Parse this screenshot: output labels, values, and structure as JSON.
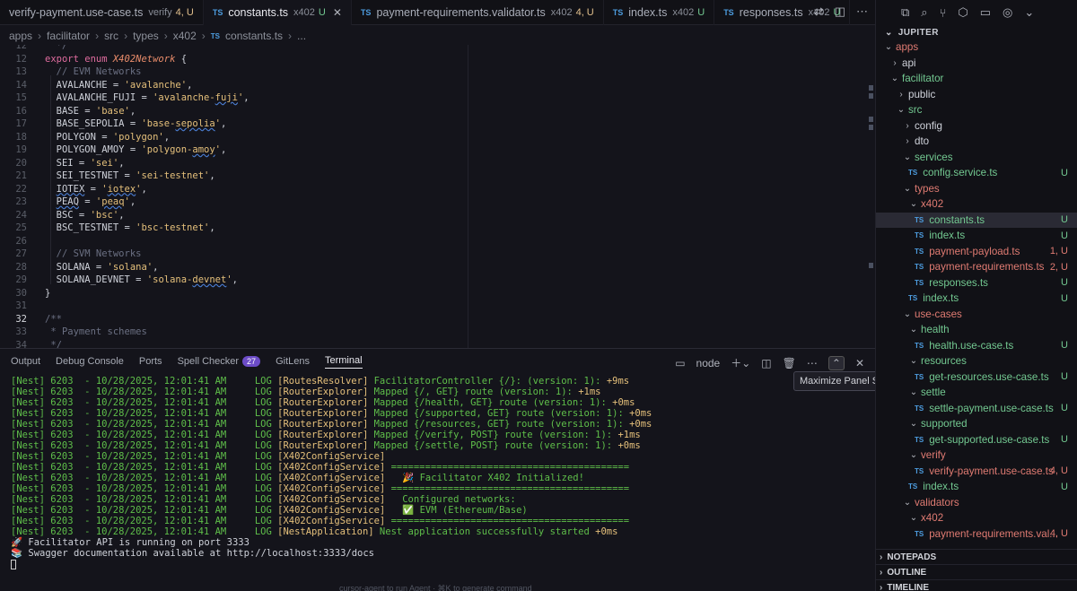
{
  "tabs": [
    {
      "label": "verify-payment.use-case.ts",
      "hint": "verify",
      "status": "4, U",
      "status_color": "#e2c08d",
      "icon": ""
    },
    {
      "label": "constants.ts",
      "hint": "x402",
      "status": "U",
      "status_color": "#73c991",
      "icon": "TS",
      "close": "✕"
    },
    {
      "label": "payment-requirements.validator.ts",
      "hint": "x402",
      "status": "4, U",
      "status_color": "#e2c08d",
      "icon": "TS"
    },
    {
      "label": "index.ts",
      "hint": "x402",
      "status": "U",
      "status_color": "#73c991",
      "icon": "TS"
    },
    {
      "label": "responses.ts",
      "hint": "x402",
      "status": "U",
      "status_color": "#73c991",
      "icon": "TS"
    }
  ],
  "breadcrumb": [
    "apps",
    "facilitator",
    "src",
    "types",
    "x402",
    "constants.ts",
    "..."
  ],
  "breadcrumb_icon": "TS",
  "code_lines": [
    {
      "n": "12",
      "parts": [
        {
          "t": "  */",
          "c": "cm"
        }
      ]
    },
    {
      "n": "12",
      "parts": [
        {
          "t": "export enum ",
          "c": "kw"
        },
        {
          "t": "X402Network",
          "c": "ty"
        },
        {
          "t": " {",
          "c": ""
        }
      ]
    },
    {
      "n": "13",
      "parts": [
        {
          "t": "  // EVM Networks",
          "c": "cm"
        }
      ]
    },
    {
      "n": "14",
      "parts": [
        {
          "t": "  AVALANCHE = ",
          "c": ""
        },
        {
          "t": "'avalanche'",
          "c": "str"
        },
        {
          "t": ",",
          "c": ""
        }
      ]
    },
    {
      "n": "15",
      "parts": [
        {
          "t": "  AVALANCHE_FUJI = ",
          "c": ""
        },
        {
          "t": "'avalanche-",
          "c": "str"
        },
        {
          "t": "fuji",
          "c": "str sq"
        },
        {
          "t": "'",
          "c": "str"
        },
        {
          "t": ",",
          "c": ""
        }
      ]
    },
    {
      "n": "16",
      "parts": [
        {
          "t": "  BASE = ",
          "c": ""
        },
        {
          "t": "'base'",
          "c": "str"
        },
        {
          "t": ",",
          "c": ""
        }
      ]
    },
    {
      "n": "17",
      "parts": [
        {
          "t": "  BASE_SEPOLIA = ",
          "c": ""
        },
        {
          "t": "'base-",
          "c": "str"
        },
        {
          "t": "sepolia",
          "c": "str sq"
        },
        {
          "t": "'",
          "c": "str"
        },
        {
          "t": ",",
          "c": ""
        }
      ]
    },
    {
      "n": "18",
      "parts": [
        {
          "t": "  POLYGON = ",
          "c": ""
        },
        {
          "t": "'polygon'",
          "c": "str"
        },
        {
          "t": ",",
          "c": ""
        }
      ]
    },
    {
      "n": "19",
      "parts": [
        {
          "t": "  POLYGON_AMOY = ",
          "c": ""
        },
        {
          "t": "'polygon-",
          "c": "str"
        },
        {
          "t": "amoy",
          "c": "str sq"
        },
        {
          "t": "'",
          "c": "str"
        },
        {
          "t": ",",
          "c": ""
        }
      ]
    },
    {
      "n": "20",
      "parts": [
        {
          "t": "  SEI = ",
          "c": ""
        },
        {
          "t": "'sei'",
          "c": "str"
        },
        {
          "t": ",",
          "c": ""
        }
      ]
    },
    {
      "n": "21",
      "parts": [
        {
          "t": "  SEI_TESTNET = ",
          "c": ""
        },
        {
          "t": "'sei-testnet'",
          "c": "str"
        },
        {
          "t": ",",
          "c": ""
        }
      ]
    },
    {
      "n": "22",
      "parts": [
        {
          "t": "  ",
          "c": ""
        },
        {
          "t": "IOTEX",
          "c": "sq"
        },
        {
          "t": " = ",
          "c": ""
        },
        {
          "t": "'",
          "c": "str"
        },
        {
          "t": "iotex",
          "c": "str sq"
        },
        {
          "t": "'",
          "c": "str"
        },
        {
          "t": ",",
          "c": ""
        }
      ]
    },
    {
      "n": "23",
      "parts": [
        {
          "t": "  ",
          "c": ""
        },
        {
          "t": "PEAQ",
          "c": "sq"
        },
        {
          "t": " = ",
          "c": ""
        },
        {
          "t": "'",
          "c": "str"
        },
        {
          "t": "peaq",
          "c": "str sq"
        },
        {
          "t": "'",
          "c": "str"
        },
        {
          "t": ",",
          "c": ""
        }
      ]
    },
    {
      "n": "24",
      "parts": [
        {
          "t": "  BSC = ",
          "c": ""
        },
        {
          "t": "'bsc'",
          "c": "str"
        },
        {
          "t": ",",
          "c": ""
        }
      ]
    },
    {
      "n": "25",
      "parts": [
        {
          "t": "  BSC_TESTNET = ",
          "c": ""
        },
        {
          "t": "'bsc-testnet'",
          "c": "str"
        },
        {
          "t": ",",
          "c": ""
        }
      ]
    },
    {
      "n": "26",
      "parts": []
    },
    {
      "n": "27",
      "parts": [
        {
          "t": "  // SVM Networks",
          "c": "cm"
        }
      ]
    },
    {
      "n": "28",
      "parts": [
        {
          "t": "  SOLANA = ",
          "c": ""
        },
        {
          "t": "'solana'",
          "c": "str"
        },
        {
          "t": ",",
          "c": ""
        }
      ]
    },
    {
      "n": "29",
      "parts": [
        {
          "t": "  SOLANA_DEVNET = ",
          "c": ""
        },
        {
          "t": "'solana-",
          "c": "str"
        },
        {
          "t": "devnet",
          "c": "str sq"
        },
        {
          "t": "'",
          "c": "str"
        },
        {
          "t": ",",
          "c": ""
        }
      ]
    },
    {
      "n": "30",
      "parts": [
        {
          "t": "}",
          "c": ""
        }
      ]
    },
    {
      "n": "31",
      "parts": []
    },
    {
      "n": "32",
      "parts": [
        {
          "t": "/**",
          "c": "cm"
        }
      ],
      "current": true
    },
    {
      "n": "33",
      "parts": [
        {
          "t": " * Payment schemes",
          "c": "cm"
        }
      ]
    },
    {
      "n": "34",
      "parts": [
        {
          "t": " */",
          "c": "cm"
        }
      ]
    }
  ],
  "panel": {
    "tabs": [
      {
        "label": "Output"
      },
      {
        "label": "Debug Console"
      },
      {
        "label": "Ports"
      },
      {
        "label": "Spell Checker",
        "badge": "27"
      },
      {
        "label": "GitLens"
      },
      {
        "label": "Terminal",
        "active": true
      }
    ],
    "shell": "node",
    "tooltip": "Maximize Panel Size"
  },
  "terminal_lines": [
    {
      "ctx": "[RoutesResolver]",
      "msg": "FacilitatorController {/}: ",
      "plus": "+9ms"
    },
    {
      "ctx": "[RouterExplorer]",
      "msg": "Mapped {/, GET} route ",
      "plus": "+1ms"
    },
    {
      "ctx": "[RouterExplorer]",
      "msg": "Mapped {/health, GET} route ",
      "plus": "+0ms"
    },
    {
      "ctx": "[RouterExplorer]",
      "msg": "Mapped {/supported, GET} route ",
      "plus": "+0ms"
    },
    {
      "ctx": "[RouterExplorer]",
      "msg": "Mapped {/resources, GET} route ",
      "plus": "+0ms"
    },
    {
      "ctx": "[RouterExplorer]",
      "msg": "Mapped {/verify, POST} route ",
      "plus": "+1ms"
    },
    {
      "ctx": "[RouterExplorer]",
      "msg": "Mapped {/settle, POST} route ",
      "plus": "+0ms"
    },
    {
      "ctx": "[X402ConfigService]",
      "msg": "",
      "plus": ""
    },
    {
      "ctx": "[X402ConfigService]",
      "msg": "==========================================",
      "plus": ""
    },
    {
      "ctx": "[X402ConfigService]",
      "msg": "  🎉 Facilitator X402 Initialized!",
      "plus": ""
    },
    {
      "ctx": "[X402ConfigService]",
      "msg": "==========================================",
      "plus": ""
    },
    {
      "ctx": "[X402ConfigService]",
      "msg": "  Configured networks:",
      "plus": ""
    },
    {
      "ctx": "[X402ConfigService]",
      "msg": "  ✅ EVM (Ethereum/Base)",
      "plus": ""
    },
    {
      "ctx": "[X402ConfigService]",
      "msg": "==========================================",
      "plus": ""
    },
    {
      "ctx": "[NestApplication]",
      "msg": "Nest application successfully started ",
      "plus": "+0ms"
    }
  ],
  "terminal_prefix": "[Nest] 6203  - 10/28/2025, 12:01:41 AM     LOG ",
  "version_note": "(version: 1)",
  "terminal_extra": [
    "🚀 Facilitator API is running on port 3333",
    "📚 Swagger documentation available at http://localhost:3333/docs"
  ],
  "bottom_hint": "cursor-agent to run Agent · ⌘K to generate command",
  "sidebar": {
    "title": "JUPITER",
    "tree": [
      {
        "label": "apps",
        "depth": 0,
        "chev": "⌄",
        "color": "r"
      },
      {
        "label": "api",
        "depth": 1,
        "chev": "›"
      },
      {
        "label": "facilitator",
        "depth": 1,
        "chev": "⌄",
        "color": "g"
      },
      {
        "label": "public",
        "depth": 2,
        "chev": "›"
      },
      {
        "label": "src",
        "depth": 2,
        "chev": "⌄",
        "color": "g"
      },
      {
        "label": "config",
        "depth": 3,
        "chev": "›"
      },
      {
        "label": "dto",
        "depth": 3,
        "chev": "›"
      },
      {
        "label": "services",
        "depth": 3,
        "chev": "⌄",
        "color": "g"
      },
      {
        "label": "config.service.ts",
        "depth": 4,
        "ts": true,
        "color": "g",
        "status": "U"
      },
      {
        "label": "types",
        "depth": 3,
        "chev": "⌄",
        "color": "r"
      },
      {
        "label": "x402",
        "depth": 4,
        "chev": "⌄",
        "color": "r"
      },
      {
        "label": "constants.ts",
        "depth": 5,
        "ts": true,
        "color": "g",
        "status": "U",
        "selected": true
      },
      {
        "label": "index.ts",
        "depth": 5,
        "ts": true,
        "color": "g",
        "status": "U"
      },
      {
        "label": "payment-payload.ts",
        "depth": 5,
        "ts": true,
        "color": "r",
        "status": "1, U",
        "status_red": true
      },
      {
        "label": "payment-requirements.ts",
        "depth": 5,
        "ts": true,
        "color": "r",
        "status": "2, U",
        "status_red": true
      },
      {
        "label": "responses.ts",
        "depth": 5,
        "ts": true,
        "color": "g",
        "status": "U"
      },
      {
        "label": "index.ts",
        "depth": 4,
        "ts": true,
        "color": "g",
        "status": "U"
      },
      {
        "label": "use-cases",
        "depth": 3,
        "chev": "⌄",
        "color": "r"
      },
      {
        "label": "health",
        "depth": 4,
        "chev": "⌄",
        "color": "g"
      },
      {
        "label": "health.use-case.ts",
        "depth": 5,
        "ts": true,
        "color": "g",
        "status": "U"
      },
      {
        "label": "resources",
        "depth": 4,
        "chev": "⌄",
        "color": "g"
      },
      {
        "label": "get-resources.use-case.ts",
        "depth": 5,
        "ts": true,
        "color": "g",
        "status": "U"
      },
      {
        "label": "settle",
        "depth": 4,
        "chev": "⌄",
        "color": "g"
      },
      {
        "label": "settle-payment.use-case.ts",
        "depth": 5,
        "ts": true,
        "color": "g",
        "status": "U"
      },
      {
        "label": "supported",
        "depth": 4,
        "chev": "⌄",
        "color": "g"
      },
      {
        "label": "get-supported.use-case.ts",
        "depth": 5,
        "ts": true,
        "color": "g",
        "status": "U"
      },
      {
        "label": "verify",
        "depth": 4,
        "chev": "⌄",
        "color": "r"
      },
      {
        "label": "verify-payment.use-case.ts",
        "depth": 5,
        "ts": true,
        "color": "r",
        "status": "4, U",
        "status_red": true
      },
      {
        "label": "index.ts",
        "depth": 4,
        "ts": true,
        "color": "g",
        "status": "U"
      },
      {
        "label": "validators",
        "depth": 3,
        "chev": "⌄",
        "color": "r"
      },
      {
        "label": "x402",
        "depth": 4,
        "chev": "⌄",
        "color": "r"
      },
      {
        "label": "payment-requirements.val...",
        "depth": 5,
        "ts": true,
        "color": "r",
        "status": "4, U",
        "status_red": true
      }
    ],
    "sections": [
      "NOTEPADS",
      "OUTLINE",
      "TIMELINE"
    ]
  }
}
